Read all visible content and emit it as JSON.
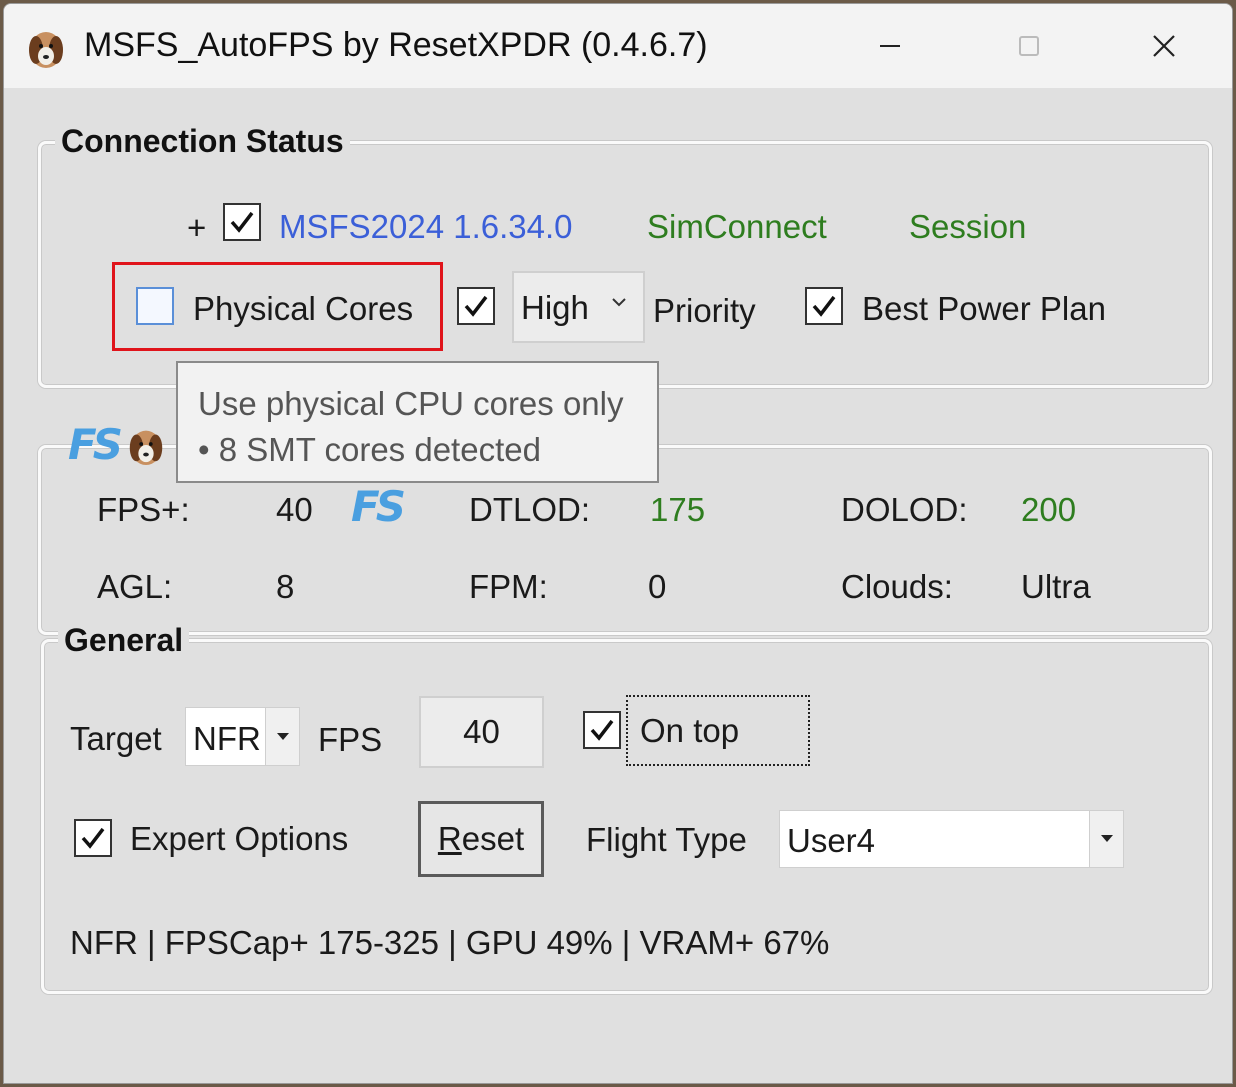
{
  "window": {
    "title": "MSFS_AutoFPS by ResetXPDR (0.4.6.7)"
  },
  "connection": {
    "legend": "Connection Status",
    "plus": "+",
    "sim_version": "MSFS2024 1.6.34.0",
    "simconnect": "SimConnect",
    "session": "Session",
    "physical_cores_label": "Physical Cores",
    "priority_value": "High",
    "priority_label": "Priority",
    "power_plan_label": "Best Power Plan"
  },
  "tooltip": {
    "line1": "Use physical CPU cores only",
    "line2": "• 8 SMT cores detected"
  },
  "stats": {
    "fps_label": "FPS+:",
    "fps_value": "40",
    "dtlod_label": "DTLOD:",
    "dtlod_value": "175",
    "dolod_label": "DOLOD:",
    "dolod_value": "200",
    "agl_label": "AGL:",
    "agl_value": "8",
    "fpm_label": "FPM:",
    "fpm_value": "0",
    "clouds_label": "Clouds:",
    "clouds_value": "Ultra"
  },
  "general": {
    "legend": "General",
    "target_label": "Target",
    "target_value": "NFR",
    "fps_label": "FPS",
    "fps_value": "40",
    "on_top_label": "On top",
    "expert_label": "Expert Options",
    "reset_label": "Reset",
    "flight_type_label": "Flight Type",
    "flight_type_value": "User4",
    "status_line": "NFR | FPSCap+ 175-325 | GPU 49% | VRAM+ 67%"
  },
  "fs_logo_text": "FS",
  "icons": [
    "app-dog-icon",
    "minimize-icon",
    "maximize-icon",
    "close-icon",
    "checkmark-icon",
    "chevron-down-icon",
    "dropdown-arrow-icon",
    "fs-logo-icon"
  ],
  "colors": {
    "accent_blue": "#3b5fd8",
    "status_green": "#2e7d1f",
    "highlight_red": "#e0141b"
  }
}
